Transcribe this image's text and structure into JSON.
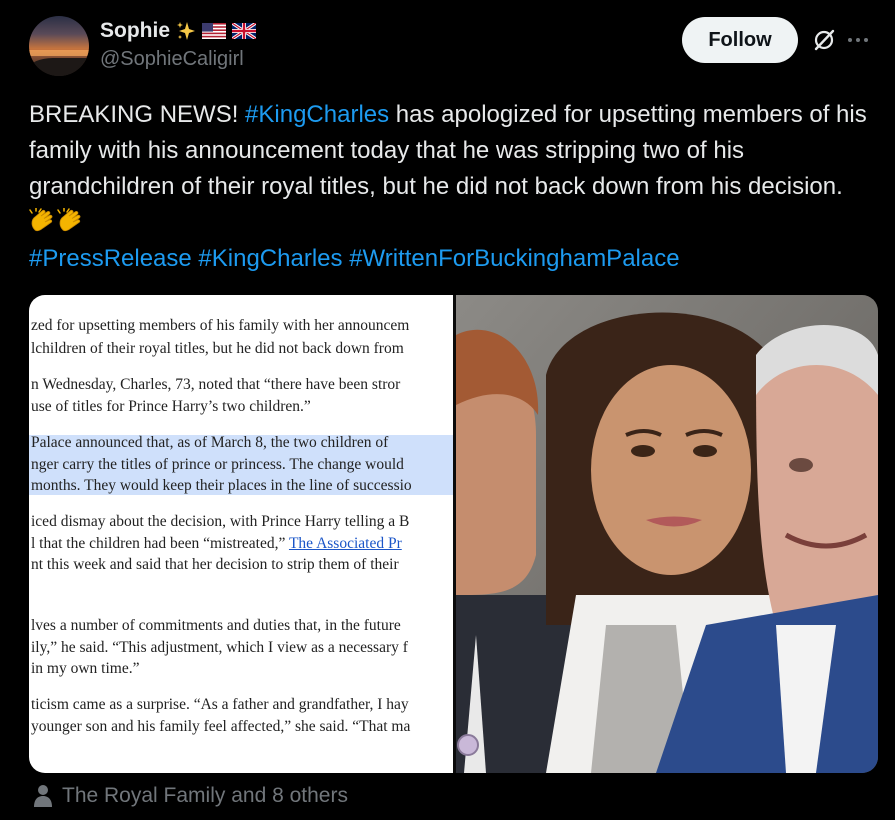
{
  "author": {
    "display_name": "Sophie",
    "handle": "@SophieCaligirl",
    "badges": [
      "sparkles-icon",
      "us-flag-icon",
      "uk-flag-icon"
    ]
  },
  "actions": {
    "follow_label": "Follow"
  },
  "tweet": {
    "segments": {
      "s1": "BREAKING NEWS! ",
      "s2": "#KingCharles",
      "s3": " has apologized for upsetting members of his family with his announcement today that he was stripping two of his grandchildren of their royal titles, but he did not back down from his decision."
    },
    "hashtags": [
      "#PressRelease",
      "#KingCharles",
      "#WrittenForBuckinghamPalace"
    ]
  },
  "media": {
    "document_lines": [
      "zed for upsetting members of his family with her announcem",
      "lchildren of their royal titles, but he did not back down from",
      "n Wednesday, Charles, 73, noted that “there have been stror",
      "use of titles for Prince Harry’s two children.”",
      "Palace announced  that, as of March 8, the two children of",
      "nger carry the titles of prince or princess. The change would",
      "months. They would keep their places in the line of successio",
      "iced dismay about the decision, with Prince Harry telling a B",
      "l that the children had been “mistreated,” ",
      "The Associated Pr",
      "nt this week and said that her decision to strip them of their",
      "lves a number of commitments and duties that, in the future",
      "ily,” he said. “This adjustment, which I view as a necessary f",
      "in my own time.”",
      "ticism came as a surprise. “As a father and grandfather, I hay",
      "younger son and his family feel affected,” she said. “That ma"
    ]
  },
  "footer": {
    "tagged_text": "The Royal Family and 8 others"
  },
  "colors": {
    "background": "#000000",
    "text": "#e7e9ea",
    "muted": "#71767b",
    "link": "#1d9bf0",
    "follow_bg": "#eff3f4"
  }
}
